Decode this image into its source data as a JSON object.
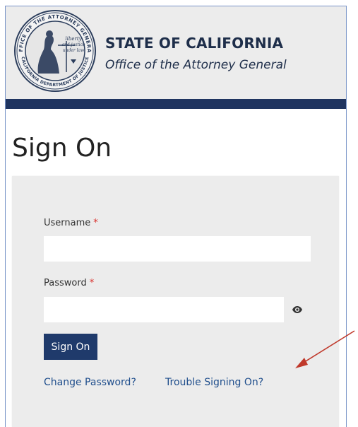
{
  "header": {
    "org_title": "STATE OF CALIFORNIA",
    "org_subtitle": "Office of the Attorney General",
    "seal": {
      "outer_text_top": "OFFICE OF THE ATTORNEY GENERAL",
      "outer_text_bottom": "CALIFORNIA DEPARTMENT OF JUSTICE",
      "inner_text": [
        "liberty",
        "and justice",
        "under law"
      ]
    }
  },
  "page": {
    "title": "Sign On"
  },
  "form": {
    "username_label": "Username",
    "password_label": "Password",
    "required_marker": "*",
    "username_value": "",
    "password_value": "",
    "signon_label": "Sign On",
    "change_password_link": "Change Password?",
    "trouble_link": "Trouble Signing On?"
  },
  "icons": {
    "password_toggle": "eye-icon"
  },
  "colors": {
    "brand_navy": "#1f3460",
    "button_bg": "#1f3a6b",
    "link": "#1f4e8c",
    "required": "#d9302c",
    "panel_bg": "#ececec",
    "annotation_arrow": "#c0392b"
  }
}
